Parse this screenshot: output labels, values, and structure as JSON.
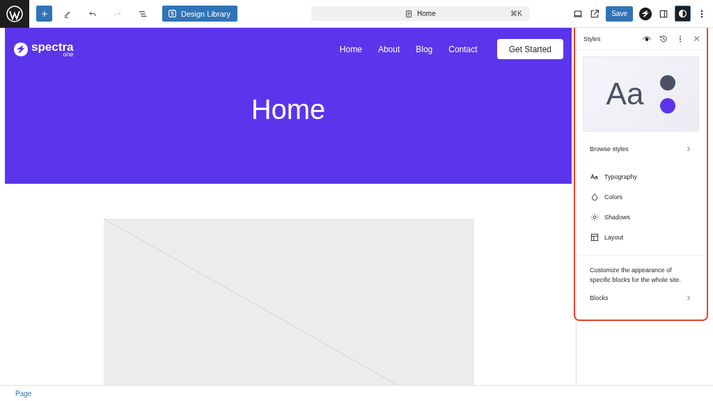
{
  "toolbar": {
    "tools": [
      {
        "kind": "add",
        "disabled": false
      },
      {
        "kind": "edit",
        "disabled": false
      },
      {
        "kind": "undo",
        "disabled": false
      },
      {
        "kind": "redo",
        "disabled": true
      },
      {
        "kind": "outline",
        "disabled": false
      }
    ],
    "design_library": "Design Library"
  },
  "command_bar": {
    "title": "Home",
    "shortcut": "⌘K"
  },
  "actions": {
    "save": "Save",
    "styles_toggle": {
      "selected": true
    }
  },
  "site": {
    "logo": "spectra",
    "logo_sub": "one",
    "nav": [
      "Home",
      "About",
      "Blog",
      "Contact"
    ],
    "cta": "Get Started",
    "hero_title": "Home"
  },
  "styles_panel": {
    "title": "Styles",
    "preview_text": "Aa",
    "preview_colors": [
      {
        "color": "#4b5163"
      },
      {
        "color": "#5b35eb"
      }
    ],
    "browse": "Browse styles",
    "items": [
      {
        "kind": "typography",
        "label": "Typography"
      },
      {
        "kind": "colors",
        "label": "Colors"
      },
      {
        "kind": "shadows",
        "label": "Shadows"
      },
      {
        "kind": "layout",
        "label": "Layout"
      }
    ],
    "description": "Customize the appearance of specific blocks for the whole site.",
    "blocks": "Blocks"
  },
  "status_bar": {
    "breadcrumb": "Page"
  }
}
